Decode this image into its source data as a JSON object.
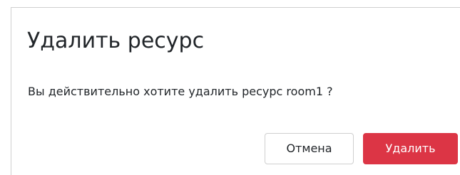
{
  "dialog": {
    "title": "Удалить ресурс",
    "message": "Вы действительно хотите удалить ресурс room1 ?",
    "cancel_label": "Отмена",
    "delete_label": "Удалить"
  },
  "colors": {
    "danger": "#dc3545",
    "border": "#cfcfcf",
    "text": "#212529"
  }
}
